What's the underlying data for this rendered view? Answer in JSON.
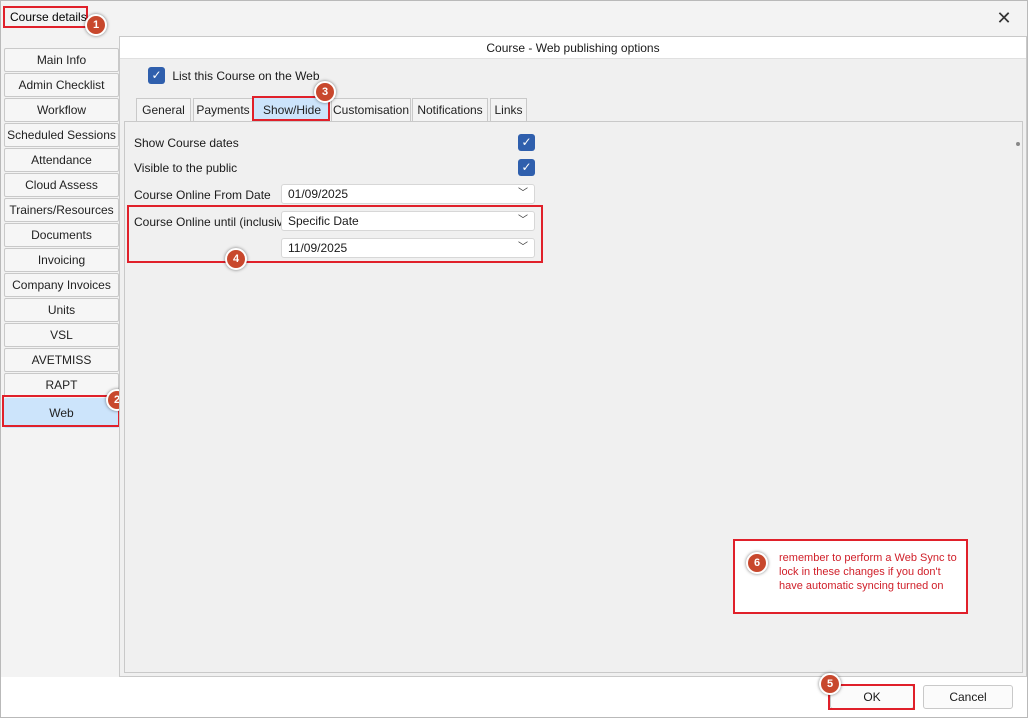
{
  "window": {
    "title": "Course details",
    "close_glyph": "✕"
  },
  "nav": {
    "items": [
      {
        "label": "Main Info"
      },
      {
        "label": "Admin Checklist"
      },
      {
        "label": "Workflow"
      },
      {
        "label": "Scheduled Sessions"
      },
      {
        "label": "Attendance"
      },
      {
        "label": "Cloud Assess"
      },
      {
        "label": "Trainers/Resources"
      },
      {
        "label": "Documents"
      },
      {
        "label": "Invoicing"
      },
      {
        "label": "Company Invoices"
      },
      {
        "label": "Units"
      },
      {
        "label": "VSL"
      },
      {
        "label": "AVETMISS"
      },
      {
        "label": "RAPT"
      },
      {
        "label": "Web"
      }
    ],
    "active": "Web"
  },
  "panel": {
    "header": "Course - Web publishing options",
    "list_on_web": {
      "label": "List this Course on the Web",
      "checked": true
    },
    "tabs": [
      {
        "label": "General"
      },
      {
        "label": "Payments"
      },
      {
        "label": "Show/Hide"
      },
      {
        "label": "Customisation"
      },
      {
        "label": "Notifications"
      },
      {
        "label": "Links"
      }
    ],
    "active_tab": "Show/Hide",
    "show_hide": {
      "show_course_dates": {
        "label": "Show Course dates",
        "checked": true
      },
      "visible_to_public": {
        "label": "Visible to the public",
        "checked": true
      },
      "online_from": {
        "label": "Course Online From Date",
        "value": "01/09/2025"
      },
      "online_until": {
        "label": "Course Online until (inclusive)",
        "mode": "Specific Date",
        "date": "11/09/2025"
      }
    }
  },
  "annotations": {
    "badges": [
      "1",
      "2",
      "3",
      "4",
      "5",
      "6"
    ],
    "note": "remember to perform a Web Sync to lock in these changes if you don't have automatic syncing turned on",
    "color": "#e0202a",
    "badge_color": "#c8482d"
  },
  "footer": {
    "ok": "OK",
    "cancel": "Cancel"
  },
  "icons": {
    "check": "check-icon",
    "chevron": "chevron-down-icon",
    "close": "close-icon"
  }
}
